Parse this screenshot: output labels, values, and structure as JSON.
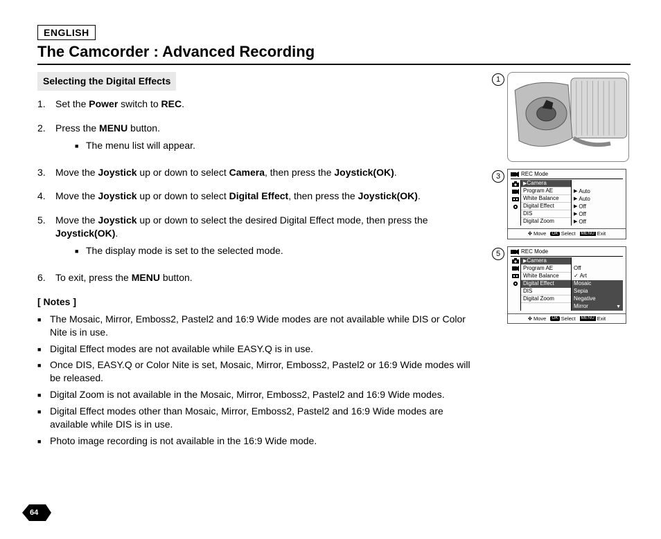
{
  "language_badge": "ENGLISH",
  "page_title": "The Camcorder : Advanced Recording",
  "section_header": "Selecting the Digital Effects",
  "steps": [
    {
      "html": "Set the <b>Power</b> switch to <b>REC</b>."
    },
    {
      "html": "Press the <b>MENU</b> button.",
      "sub": [
        "The menu list will appear."
      ]
    },
    {
      "html": "Move the <b>Joystick</b> up or down to select <b>Camera</b>, then press the <b>Joystick(OK)</b>."
    },
    {
      "html": "Move the <b>Joystick</b> up or down to select <b>Digital Effect</b>, then press the <b>Joystick(OK)</b>."
    },
    {
      "html": "Move the <b>Joystick</b> up or down to select the desired Digital Effect mode, then press the <b>Joystick(OK)</b>.",
      "sub": [
        "The display mode is set to the selected mode."
      ]
    },
    {
      "html": "To exit, press the <b>MENU</b> button."
    }
  ],
  "notes_header": "[ Notes ]",
  "notes": [
    "The Mosaic, Mirror, Emboss2, Pastel2 and 16:9 Wide modes are not available while DIS or Color Nite is in use.",
    "Digital Effect modes are not available while EASY.Q is in use.",
    "Once DIS, EASY.Q or Color Nite is set, Mosaic, Mirror, Emboss2, Pastel2 or 16:9 Wide modes will be released.",
    "Digital Zoom is not available in the Mosaic, Mirror, Emboss2, Pastel2 and 16:9 Wide modes.",
    "Digital Effect modes other than Mosaic, Mirror, Emboss2, Pastel2 and 16:9 Wide modes are available while DIS is in use.",
    "Photo image recording is not available in the 16:9 Wide mode."
  ],
  "callouts": {
    "illustration": "1",
    "menu_a": "3",
    "menu_b": "5"
  },
  "menu_a": {
    "mode": "REC Mode",
    "header": "Camera",
    "side_icons": [
      "camera",
      "camcorder",
      "tape",
      "gear"
    ],
    "items": [
      {
        "label": "Program AE",
        "value": "Auto"
      },
      {
        "label": "White Balance",
        "value": "Auto"
      },
      {
        "label": "Digital Effect",
        "value": "Off"
      },
      {
        "label": "DIS",
        "value": "Off"
      },
      {
        "label": "Digital Zoom",
        "value": "Off"
      }
    ],
    "footer": {
      "move": "Move",
      "select": "Select",
      "exit": "Exit",
      "ok": "OK",
      "menu": "MENU"
    }
  },
  "menu_b": {
    "mode": "REC Mode",
    "header": "Camera",
    "side_icons": [
      "camera",
      "camcorder",
      "tape",
      "gear"
    ],
    "items": [
      {
        "label": "Program AE",
        "value": "Off"
      },
      {
        "label": "White Balance",
        "value": "Art",
        "value_selected": true
      },
      {
        "label": "Digital Effect",
        "label_hl": true,
        "value": "Mosaic",
        "value_hl": true
      },
      {
        "label": "DIS",
        "value": "Sepia",
        "value_hl": true
      },
      {
        "label": "Digital Zoom",
        "value": "Negative",
        "value_hl": true
      },
      {
        "label": "",
        "value": "Mirror",
        "value_hl": true,
        "scroll": true
      }
    ],
    "footer": {
      "move": "Move",
      "select": "Select",
      "exit": "Exit",
      "ok": "OK",
      "menu": "MENU"
    }
  },
  "page_number": "64"
}
